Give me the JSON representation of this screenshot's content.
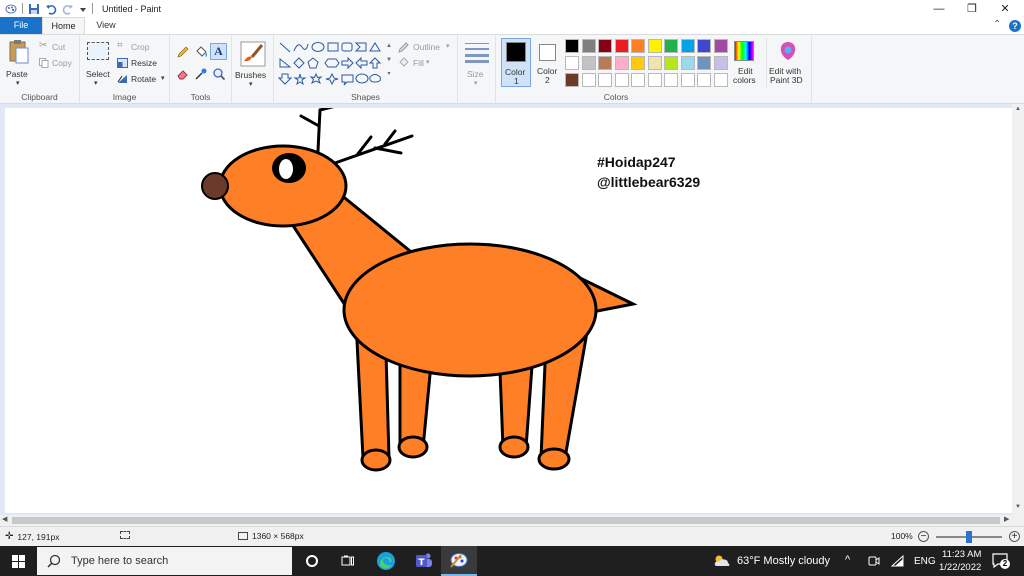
{
  "window": {
    "title": "Untitled - Paint",
    "minimize_glyph": "—",
    "restore_glyph": "❐",
    "close_glyph": "✕",
    "collapse_glyph": "⌃",
    "help_glyph": "?"
  },
  "tabs": {
    "file": "File",
    "home": "Home",
    "view": "View"
  },
  "ribbon": {
    "clipboard": {
      "label": "Clipboard",
      "paste": "Paste",
      "cut": "Cut",
      "copy": "Copy"
    },
    "image": {
      "label": "Image",
      "select": "Select",
      "crop": "Crop",
      "resize": "Resize",
      "rotate": "Rotate"
    },
    "tools": {
      "label": "Tools"
    },
    "brushes": {
      "label": "Brushes"
    },
    "shapes": {
      "label": "Shapes",
      "outline": "Outline",
      "fill": "Fill"
    },
    "size": {
      "label": "Size"
    },
    "colors": {
      "label": "Colors",
      "color1": "Color\n1",
      "color1_line1": "Color",
      "color1_line2": "1",
      "color2_line1": "Color",
      "color2_line2": "2",
      "edit_colors_line1": "Edit",
      "edit_colors_line2": "colors",
      "paint3d_line1": "Edit with",
      "paint3d_line2": "Paint 3D",
      "palette_row1": [
        "#000000",
        "#7f7f7f",
        "#880015",
        "#ed1c24",
        "#ff7f27",
        "#fff200",
        "#22b14c",
        "#00a2e8",
        "#3f48cc",
        "#a349a4"
      ],
      "palette_row2": [
        "#ffffff",
        "#c3c3c3",
        "#b97a57",
        "#ffaec9",
        "#ffc90e",
        "#efe4b0",
        "#b5e61d",
        "#99d9ea",
        "#7092be",
        "#c8bfe7"
      ],
      "palette_row3": [
        "#6b3a2a",
        "#ffffff",
        "#ffffff",
        "#ffffff",
        "#ffffff",
        "#ffffff",
        "#ffffff",
        "#ffffff",
        "#ffffff",
        "#ffffff"
      ]
    }
  },
  "canvas": {
    "text_line1": "#Hoidap247",
    "text_line2": "@littlebear6329",
    "deer_body_color": "#ff7f27",
    "deer_nose_color": "#6b3a2a"
  },
  "statusbar": {
    "cursor_pos": "127, 191px",
    "image_size": "1360 × 568px",
    "zoom": "100%",
    "zoom_fraction": 0.5
  },
  "taskbar": {
    "search_placeholder": "Type here to search",
    "weather": "63°F  Mostly cloudy",
    "language": "ENG",
    "time": "11:23 AM",
    "date": "1/22/2022",
    "notifications": "2"
  }
}
